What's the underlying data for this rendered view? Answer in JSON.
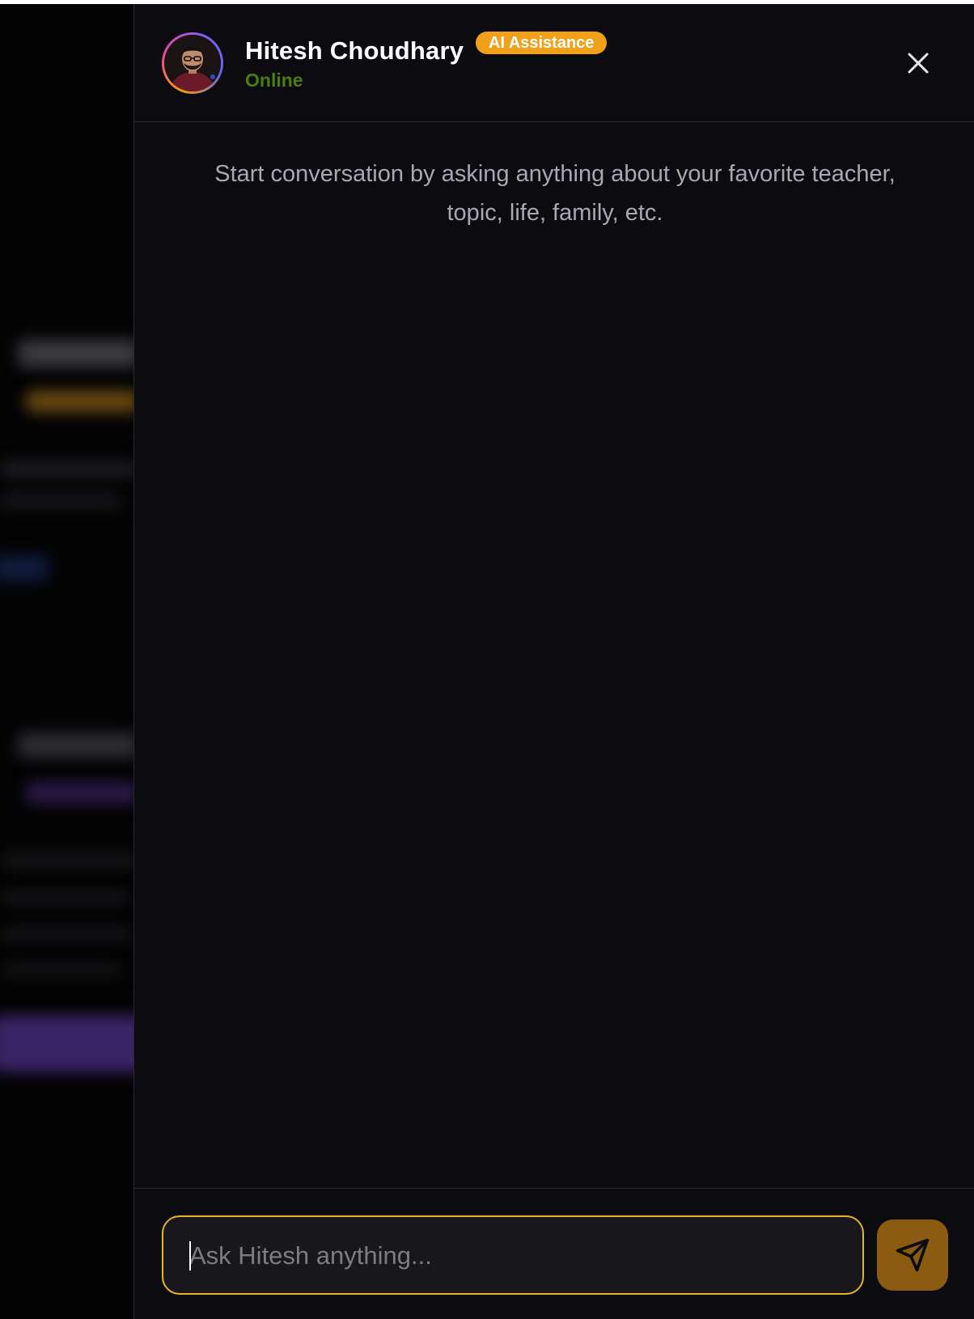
{
  "header": {
    "name": "Hitesh Choudhary",
    "badge": "AI Assistance",
    "status": "Online",
    "close_icon": "close-icon",
    "avatar_alt": "Hitesh Choudhary"
  },
  "chat": {
    "intro_line1": "Start conversation by asking anything about your favorite teacher,",
    "intro_line2": "topic, life, family, etc."
  },
  "composer": {
    "placeholder": "Ask Hitesh anything...",
    "value": "",
    "send_icon": "send-icon"
  },
  "colors": {
    "accent": "#f0a019",
    "status": "#4d7c0f",
    "panel_bg": "#0c0c10",
    "send_button": "#8a5b10"
  }
}
